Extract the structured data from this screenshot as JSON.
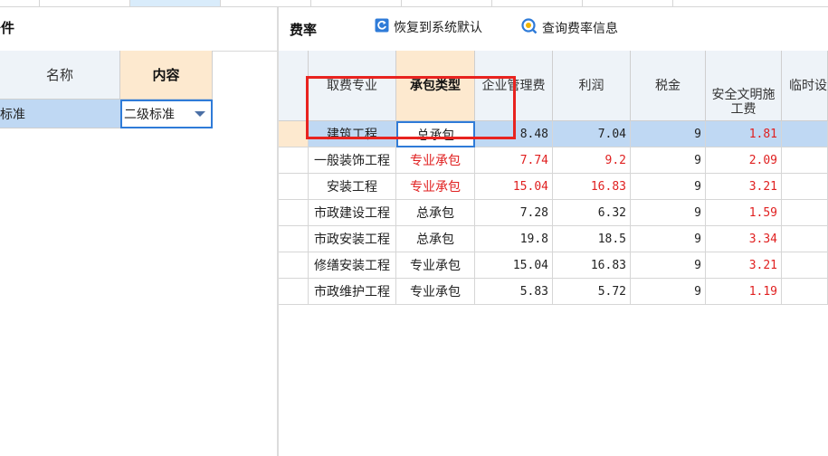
{
  "left": {
    "title": "条件",
    "headers": {
      "name": "名称",
      "content": "内容"
    },
    "row": {
      "name": "地标准",
      "value": "二级标准"
    }
  },
  "right": {
    "title": "费率",
    "toolbar": {
      "restore": "恢复到系统默认",
      "query": "查询费率信息"
    },
    "columns": [
      "取费专业",
      "承包类型",
      "企业管理费",
      "利润",
      "税金",
      "安全文明施工费",
      "临时设"
    ],
    "rows": [
      [
        "建筑工程",
        "总承包",
        "8.48",
        "7.04",
        "9",
        "1.81",
        ""
      ],
      [
        "一般装饰工程",
        "专业承包",
        "7.74",
        "9.2",
        "9",
        "2.09",
        ""
      ],
      [
        "安装工程",
        "专业承包",
        "15.04",
        "16.83",
        "9",
        "3.21",
        ""
      ],
      [
        "市政建设工程",
        "总承包",
        "7.28",
        "6.32",
        "9",
        "1.59",
        ""
      ],
      [
        "市政安装工程",
        "总承包",
        "19.8",
        "18.5",
        "9",
        "3.34",
        ""
      ],
      [
        "修缮安装工程",
        "专业承包",
        "15.04",
        "16.83",
        "9",
        "3.21",
        ""
      ],
      [
        "市政维护工程",
        "专业承包",
        "5.83",
        "5.72",
        "9",
        "1.19",
        ""
      ]
    ]
  },
  "colors": {
    "accent": "#2f7bd8",
    "highlight": "#e8231f",
    "selection": "#bfd8f3",
    "header_active": "#fde9cf"
  }
}
